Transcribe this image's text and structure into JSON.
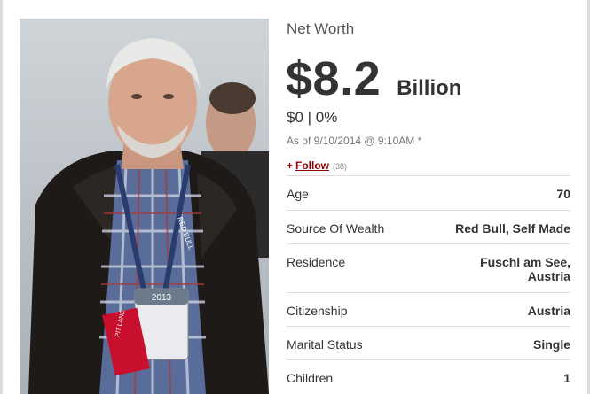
{
  "profile": {
    "title": "Net Worth",
    "net_worth_value": "$8.2",
    "net_worth_unit": "Billion",
    "change": "$0 | 0%",
    "as_of": "As of 9/10/2014 @ 9:10AM *",
    "follow_label": "Follow",
    "follow_count": "(38)"
  },
  "stats": [
    {
      "label": "Age",
      "value": "70"
    },
    {
      "label": "Source Of Wealth",
      "value": "Red Bull, Self Made"
    },
    {
      "label": "Residence",
      "value_line1": "Fuschl am See,",
      "value_line2": "Austria"
    },
    {
      "label": "Citizenship",
      "value": "Austria"
    },
    {
      "label": "Marital Status",
      "value": "Single"
    },
    {
      "label": "Children",
      "value": "1"
    }
  ],
  "photo": {
    "badge_year": "2013",
    "strip_text": "PIT LANE",
    "lanyard_text": "RED BULL"
  },
  "colors": {
    "accent": "#8b0000",
    "text": "#333333",
    "muted": "#777777",
    "divider": "#dddddd"
  }
}
